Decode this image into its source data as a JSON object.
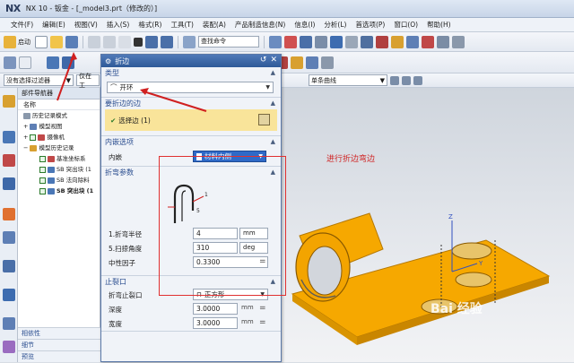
{
  "window": {
    "logo": "NX",
    "title": "NX 10 - 钣金 - [_model3.prt（修改的）]"
  },
  "menu": {
    "items": [
      "文件(F)",
      "编辑(E)",
      "视图(V)",
      "插入(S)",
      "格式(R)",
      "工具(T)",
      "装配(A)",
      "产品制造信息(N)",
      "信息(I)",
      "分析(L)",
      "首选项(P)",
      "窗口(O)",
      "帮助(H)"
    ]
  },
  "toolbar": {
    "start_label": "启动",
    "command_search_placeholder": "查找命令"
  },
  "selection_bar": {
    "filter_label": "没有选择过滤器",
    "scope_label": "仅在工",
    "curve_rule": "单条曲线"
  },
  "navigator": {
    "title": "部件导航器",
    "column_name": "名称",
    "items": [
      {
        "label": "历史记录模式",
        "indent": 0
      },
      {
        "label": "模型视图",
        "indent": 0
      },
      {
        "label": "摄像机",
        "indent": 0
      },
      {
        "label": "模型历史记录",
        "indent": 0
      },
      {
        "label": "基准坐标系",
        "indent": 1
      },
      {
        "label": "SB 突出块 (1",
        "indent": 1
      },
      {
        "label": "SB 法向除料",
        "indent": 1
      },
      {
        "label": "SB 突出块 (1",
        "indent": 1
      }
    ],
    "bottom_tabs": [
      "相依性",
      "细节",
      "预览"
    ]
  },
  "dialog": {
    "title": "折边",
    "sections": {
      "type": {
        "title": "类型",
        "value": "开环"
      },
      "edge": {
        "title": "要折边的边",
        "selected": "选择边 (1)"
      },
      "inner_edge": {
        "title": "内嵌选项",
        "label": "内嵌",
        "value": "材料内侧"
      },
      "bend": {
        "title": "折弯参数",
        "params": [
          {
            "label": "1.折弯半径",
            "value": "4",
            "unit": "mm"
          },
          {
            "label": "5.扫掠角度",
            "value": "310",
            "unit": "deg"
          },
          {
            "label": "中性因子",
            "value": "0.3300",
            "unit": ""
          }
        ]
      },
      "relief": {
        "title": "止裂口",
        "rows": [
          {
            "label": "折弯止裂口",
            "value": "正方形"
          },
          {
            "label": "深度",
            "value": "3.0000",
            "unit": "mm"
          },
          {
            "label": "宽度",
            "value": "3.0000",
            "unit": "mm"
          }
        ]
      }
    }
  },
  "annotation": "进行折边弯边",
  "watermark": "Bai 经验",
  "colors": {
    "accent_red": "#d02020",
    "part_orange": "#f6a800",
    "dialog_highlight": "#f9e49a"
  }
}
